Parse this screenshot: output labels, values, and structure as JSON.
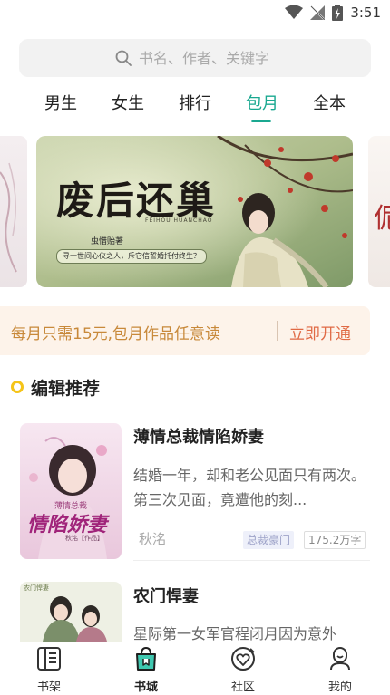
{
  "status_bar": {
    "time": "3:51"
  },
  "search": {
    "placeholder": "书名、作者、关键字"
  },
  "tabs": [
    {
      "label": "男生"
    },
    {
      "label": "女生"
    },
    {
      "label": "排行"
    },
    {
      "label": "包月",
      "active": true
    },
    {
      "label": "全本"
    }
  ],
  "banner": {
    "title": "废后还巢",
    "subtitle": "FEIHOU HUANCHAO",
    "author": "虫惜贻",
    "author_suffix": "著",
    "tagline": "寻一世间心仪之人，斥它信誓婚托付终生？"
  },
  "banner_right": {
    "glyph": "伲"
  },
  "promo": {
    "text": "每月只需15元,包月作品任意读",
    "button": "立即开通"
  },
  "section": {
    "title": "编辑推荐"
  },
  "books": [
    {
      "title": "薄情总裁情陷娇妻",
      "description": "结婚一年，却和老公见面只有两次。第三次见面，竟遭他的刻...",
      "author": "秋洺",
      "category": "总裁豪门",
      "words": "175.2万字",
      "cover_text": {
        "top": "薄情总裁",
        "main": "情陷娇妻",
        "author": "秋洺【作品】"
      }
    },
    {
      "title": "农门悍妻",
      "description": "星际第一女军官程闭月因为意外",
      "cover_text": {
        "top": "农门悍妻"
      }
    }
  ],
  "bottom_nav": [
    {
      "label": "书架",
      "icon": "bookshelf-icon"
    },
    {
      "label": "书城",
      "icon": "bookstore-bag-icon",
      "active": true
    },
    {
      "label": "社区",
      "icon": "community-heart-icon"
    },
    {
      "label": "我的",
      "icon": "profile-icon"
    }
  ],
  "colors": {
    "accent": "#1aa890",
    "promo_bg": "#fdf3ea",
    "promo_text": "#c8893a",
    "promo_button": "#e06a45",
    "section_dot": "#f5c418"
  }
}
